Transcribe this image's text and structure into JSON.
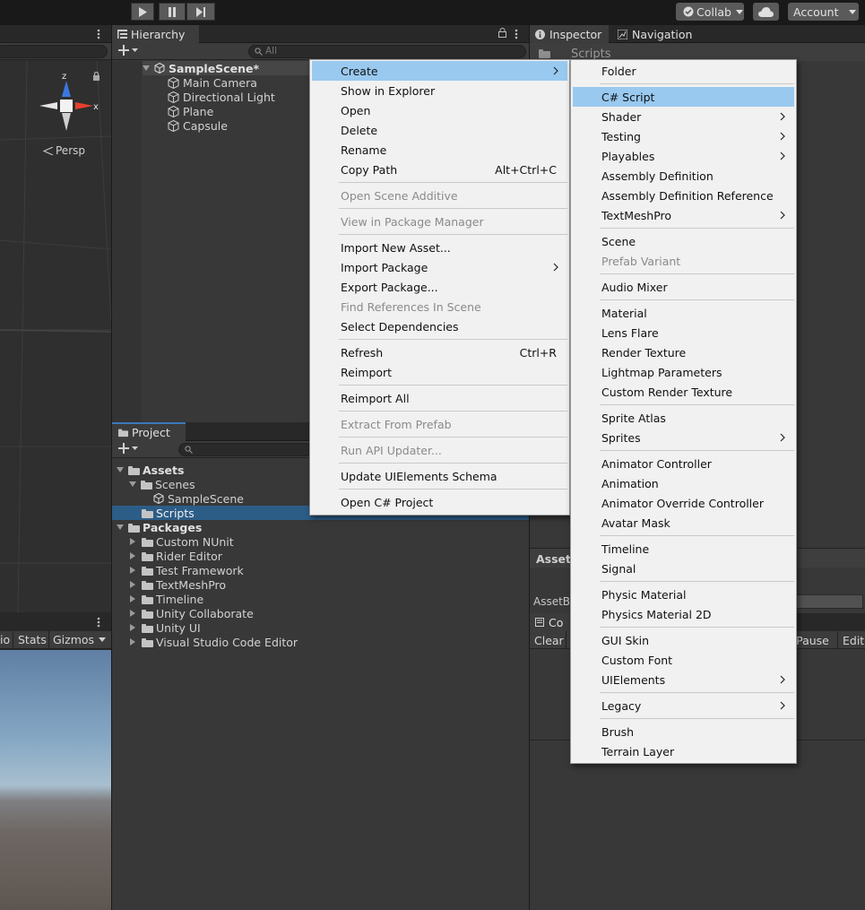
{
  "toolbar": {
    "collab_label": "Collab",
    "account_label": "Account"
  },
  "hierarchy": {
    "tab_label": "Hierarchy",
    "search_placeholder": "All",
    "scene_name": "SampleScene*",
    "objects": [
      "Main Camera",
      "Directional Light",
      "Plane",
      "Capsule"
    ]
  },
  "scene_view": {
    "gizmo_axis_z": "z",
    "gizmo_axis_x": "x",
    "persp_label": "Persp"
  },
  "game_view": {
    "toolbar_partial": "io",
    "stats_label": "Stats",
    "gizmos_label": "Gizmos"
  },
  "project": {
    "tab_label": "Project",
    "assets_label": "Assets",
    "scenes_label": "Scenes",
    "samplescene_label": "SampleScene",
    "scripts_label": "Scripts",
    "packages_label": "Packages",
    "packages": [
      "Custom NUnit",
      "Rider Editor",
      "Test Framework",
      "TextMeshPro",
      "Timeline",
      "Unity Collaborate",
      "Unity UI",
      "Visual Studio Code Editor"
    ]
  },
  "inspector": {
    "tab_label": "Inspector",
    "navigation_tab_label": "Navigation",
    "header_partial": "Scripts",
    "asset_label_partial": "Asset",
    "assetbundle_partial": "AssetB",
    "console_tab_partial": "Co",
    "clear_label": "Clear",
    "pause_label_partial": "r Pause",
    "editor_label_partial": "Edit"
  },
  "context_menu": {
    "items": [
      {
        "label": "Create",
        "arrow": true,
        "highlight": true
      },
      {
        "label": "Show in Explorer"
      },
      {
        "label": "Open"
      },
      {
        "label": "Delete"
      },
      {
        "label": "Rename"
      },
      {
        "label": "Copy Path",
        "shortcut": "Alt+Ctrl+C"
      },
      {
        "sep": true
      },
      {
        "label": "Open Scene Additive",
        "disabled": true
      },
      {
        "sep": true
      },
      {
        "label": "View in Package Manager",
        "disabled": true
      },
      {
        "sep": true
      },
      {
        "label": "Import New Asset..."
      },
      {
        "label": "Import Package",
        "arrow": true
      },
      {
        "label": "Export Package..."
      },
      {
        "label": "Find References In Scene",
        "disabled": true
      },
      {
        "label": "Select Dependencies"
      },
      {
        "sep": true
      },
      {
        "label": "Refresh",
        "shortcut": "Ctrl+R"
      },
      {
        "label": "Reimport"
      },
      {
        "sep": true
      },
      {
        "label": "Reimport All"
      },
      {
        "sep": true
      },
      {
        "label": "Extract From Prefab",
        "disabled": true
      },
      {
        "sep": true
      },
      {
        "label": "Run API Updater...",
        "disabled": true
      },
      {
        "sep": true
      },
      {
        "label": "Update UIElements Schema"
      },
      {
        "sep": true
      },
      {
        "label": "Open C# Project"
      }
    ]
  },
  "create_submenu": {
    "items": [
      {
        "label": "Folder"
      },
      {
        "sep": true
      },
      {
        "label": "C# Script",
        "highlight": true
      },
      {
        "label": "Shader",
        "arrow": true
      },
      {
        "label": "Testing",
        "arrow": true
      },
      {
        "label": "Playables",
        "arrow": true
      },
      {
        "label": "Assembly Definition"
      },
      {
        "label": "Assembly Definition Reference"
      },
      {
        "label": "TextMeshPro",
        "arrow": true
      },
      {
        "sep": true
      },
      {
        "label": "Scene"
      },
      {
        "label": "Prefab Variant",
        "disabled": true
      },
      {
        "sep": true
      },
      {
        "label": "Audio Mixer"
      },
      {
        "sep": true
      },
      {
        "label": "Material"
      },
      {
        "label": "Lens Flare"
      },
      {
        "label": "Render Texture"
      },
      {
        "label": "Lightmap Parameters"
      },
      {
        "label": "Custom Render Texture"
      },
      {
        "sep": true
      },
      {
        "label": "Sprite Atlas"
      },
      {
        "label": "Sprites",
        "arrow": true
      },
      {
        "sep": true
      },
      {
        "label": "Animator Controller"
      },
      {
        "label": "Animation"
      },
      {
        "label": "Animator Override Controller"
      },
      {
        "label": "Avatar Mask"
      },
      {
        "sep": true
      },
      {
        "label": "Timeline"
      },
      {
        "label": "Signal"
      },
      {
        "sep": true
      },
      {
        "label": "Physic Material"
      },
      {
        "label": "Physics Material 2D"
      },
      {
        "sep": true
      },
      {
        "label": "GUI Skin"
      },
      {
        "label": "Custom Font"
      },
      {
        "label": "UIElements",
        "arrow": true
      },
      {
        "sep": true
      },
      {
        "label": "Legacy",
        "arrow": true
      },
      {
        "sep": true
      },
      {
        "label": "Brush"
      },
      {
        "label": "Terrain Layer"
      }
    ]
  },
  "colors": {
    "menu_highlight": "#99c9ef",
    "selection": "#2c5d87",
    "gizmo_x": "#e8402c",
    "gizmo_y": "#8ccb3c",
    "gizmo_z": "#3b76e0"
  }
}
